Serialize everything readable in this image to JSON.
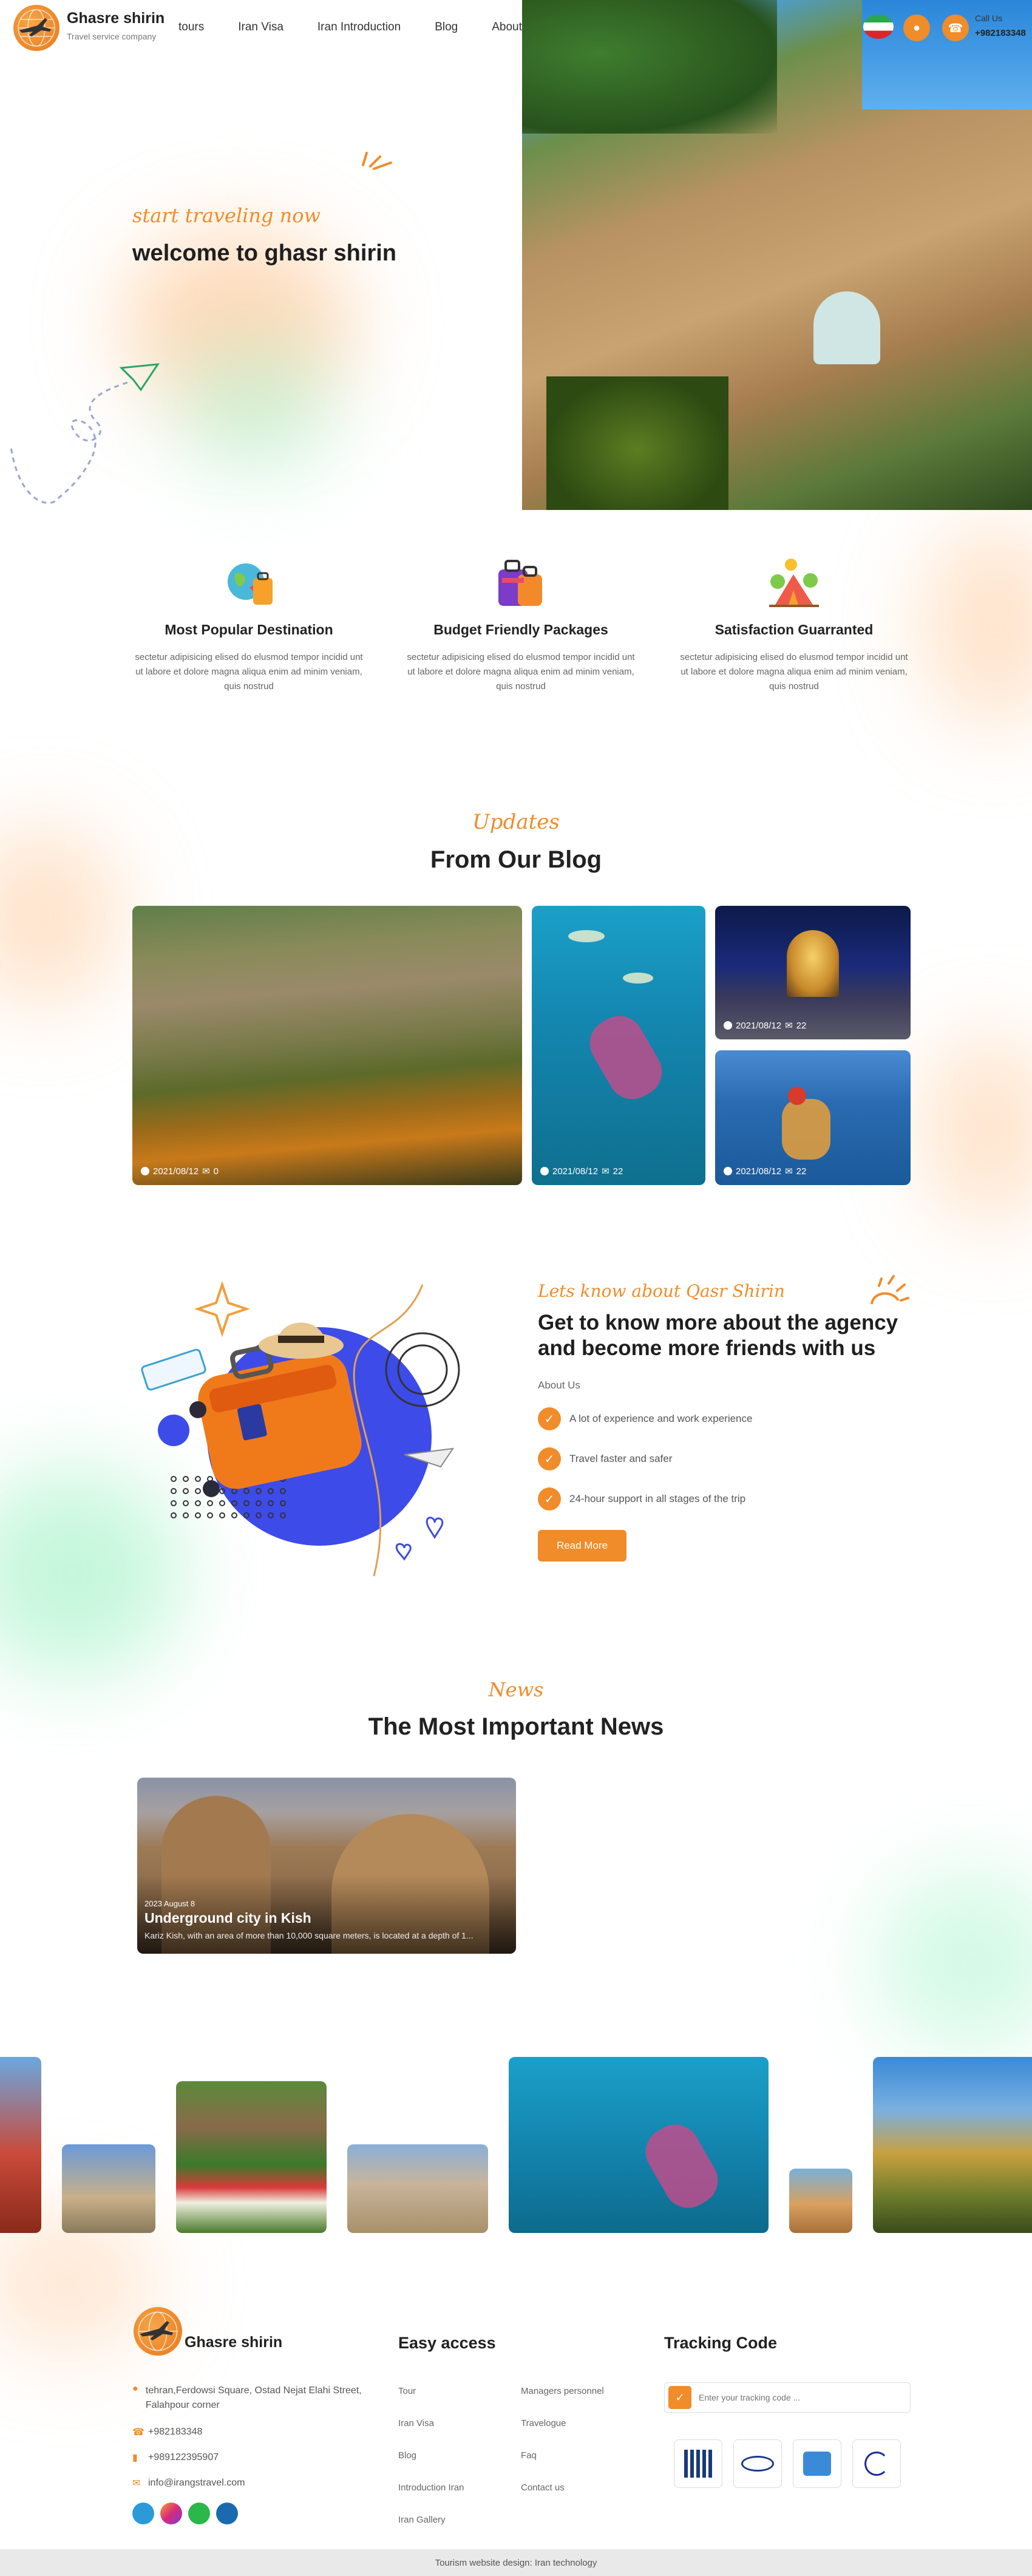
{
  "header": {
    "brand": "Ghasre shirin",
    "tagline": "Travel service company",
    "nav": [
      "tours",
      "Iran Visa",
      "Iran Introduction",
      "Blog",
      "About Us"
    ],
    "call_label": "Call Us",
    "call_number": "+982183348"
  },
  "hero": {
    "script": "start traveling now",
    "title": "welcome to ghasr shirin"
  },
  "features": [
    {
      "title": "Most Popular Destination",
      "text": "sectetur adipisicing elised do elusmod tempor incidid unt ut labore et dolore magna aliqua enim ad minim veniam, quis nostrud"
    },
    {
      "title": "Budget Friendly Packages",
      "text": "sectetur adipisicing elised do elusmod tempor incidid unt ut labore et dolore magna aliqua enim ad minim veniam, quis nostrud"
    },
    {
      "title": "Satisfaction Guarranted",
      "text": "sectetur adipisicing elised do elusmod tempor incidid unt ut labore et dolore magna aliqua enim ad minim veniam, quis nostrud"
    }
  ],
  "blog": {
    "script": "Updates",
    "title": "From Our Blog",
    "posts": [
      {
        "date": "2021/08/12",
        "comments": "0"
      },
      {
        "date": "2021/08/12",
        "comments": "22"
      },
      {
        "date": "2021/08/12",
        "comments": "22"
      },
      {
        "date": "2021/08/12",
        "comments": "22"
      }
    ]
  },
  "about": {
    "script": "Lets know about Qasr Shirin",
    "title": "Get to know more about the agency and become more friends with us",
    "label": "About Us",
    "items": [
      "A lot of experience and work experience",
      "Travel faster and safer",
      "24-hour support in all stages of the trip"
    ],
    "button": "Read More"
  },
  "news": {
    "script": "News",
    "title": "The Most Important News",
    "card": {
      "date": "2023 August 8",
      "title": "Underground city in Kish",
      "excerpt": "Kariz Kish, with an area of more than 10,000 square meters, is located at a depth of 1..."
    }
  },
  "footer": {
    "brand": "Ghasre shirin",
    "address": "tehran,Ferdowsi Square, Ostad Nejat Elahi Street, Falahpour corner",
    "phone1": "+982183348",
    "phone2": "+989122395907",
    "email": "info@irangstravel.com",
    "easy_access_title": "Easy access",
    "links_left": [
      "Tour",
      "Iran Visa",
      "Blog",
      "Introduction Iran",
      "Iran Gallery"
    ],
    "links_right": [
      "Managers personnel",
      "Travelogue",
      "Faq",
      "Contact us"
    ],
    "tracking_title": "Tracking Code",
    "tracking_placeholder": "Enter your tracking code ...",
    "bottom": "Tourism website design: Iran technology"
  },
  "colors": {
    "accent": "#f08c2a",
    "blue": "#3d4be8",
    "green": "#4ee89a"
  }
}
